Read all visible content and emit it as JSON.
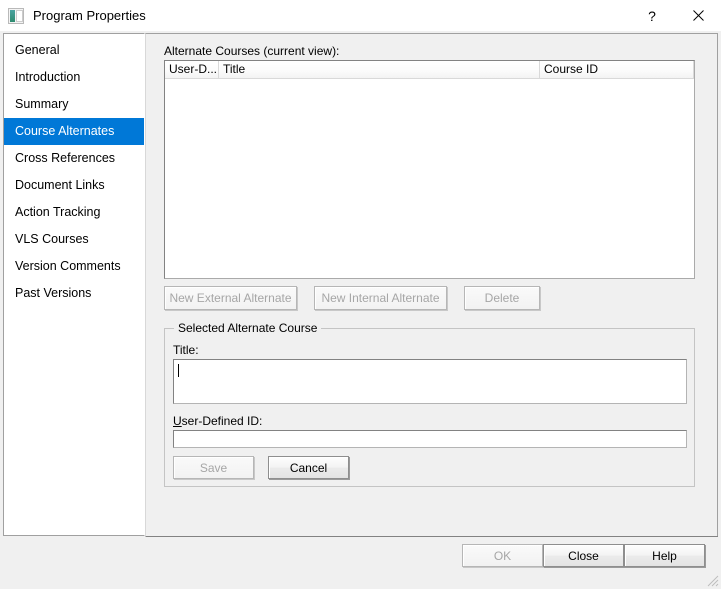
{
  "window": {
    "title": "Program Properties",
    "icon": "program-properties-icon",
    "help_button": "?",
    "close_button": "close-icon"
  },
  "sidebar": {
    "items": [
      {
        "label": "General",
        "selected": false
      },
      {
        "label": "Introduction",
        "selected": false
      },
      {
        "label": "Summary",
        "selected": false
      },
      {
        "label": "Course Alternates",
        "selected": true
      },
      {
        "label": "Cross References",
        "selected": false
      },
      {
        "label": "Document Links",
        "selected": false
      },
      {
        "label": "Action Tracking",
        "selected": false
      },
      {
        "label": "VLS Courses",
        "selected": false
      },
      {
        "label": "Version Comments",
        "selected": false
      },
      {
        "label": "Past Versions",
        "selected": false
      }
    ]
  },
  "main": {
    "list_label": "Alternate Courses (current view):",
    "columns": [
      "User-D...",
      "Title",
      "Course ID"
    ],
    "rows": [],
    "buttons": {
      "new_external": "New External Alternate",
      "new_internal": "New Internal Alternate",
      "delete": "Delete"
    },
    "groupbox": {
      "title": "Selected Alternate Course",
      "title_label": "Title:",
      "title_value": "",
      "udid_label_accel": "U",
      "udid_label_rest": "ser-Defined ID:",
      "udid_value": "",
      "save_label": "Save",
      "cancel_label": "Cancel"
    }
  },
  "footer": {
    "ok_label": "OK",
    "close_label": "Close",
    "help_label": "Help"
  },
  "colors": {
    "selection_blue": "#0078d7",
    "dialog_face": "#f0f0f0",
    "disabled_text": "#a6a6a6"
  }
}
